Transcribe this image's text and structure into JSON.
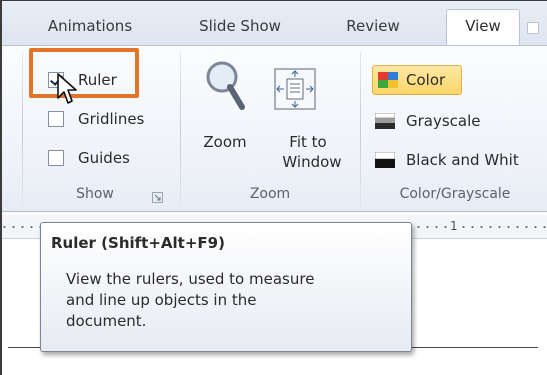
{
  "tabs": [
    {
      "label": "Animations"
    },
    {
      "label": "Slide Show"
    },
    {
      "label": "Review"
    },
    {
      "label": "View",
      "active": true
    }
  ],
  "show_group": {
    "label": "Show",
    "checkboxes": [
      {
        "label": "Ruler",
        "checked": true
      },
      {
        "label": "Gridlines",
        "checked": false
      },
      {
        "label": "Guides",
        "checked": false
      }
    ]
  },
  "zoom_group": {
    "label": "Zoom",
    "zoom_label": "Zoom",
    "fit_label_1": "Fit to",
    "fit_label_2": "Window"
  },
  "color_group": {
    "label": "Color/Grayscale",
    "items": [
      {
        "label": "Color",
        "selected": true
      },
      {
        "label": "Grayscale"
      },
      {
        "label": "Black and Whit"
      }
    ]
  },
  "ruler": {
    "number": "1"
  },
  "tooltip": {
    "title": "Ruler (Shift+Alt+F9)",
    "line1": "View the rulers, used to measure",
    "line2": "and line up objects in the",
    "line3": "document."
  },
  "colors": {
    "highlight": "#e0752b",
    "selected_fill": "#fbd56b"
  }
}
